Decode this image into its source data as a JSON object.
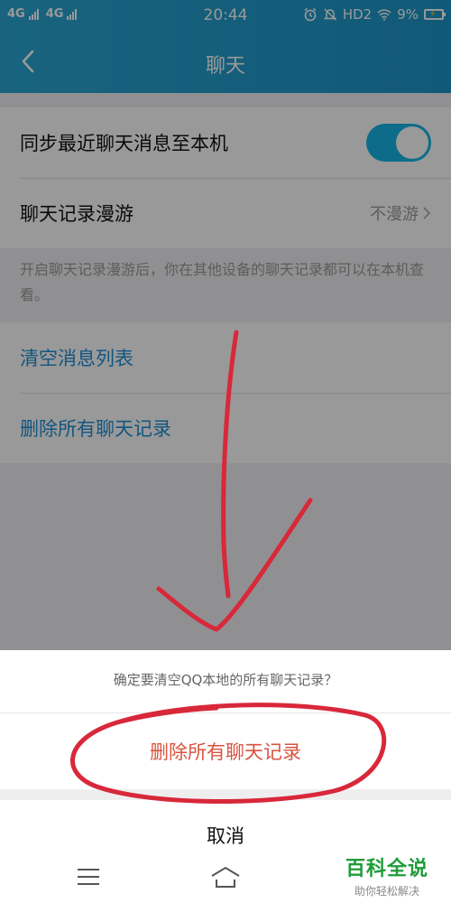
{
  "status_bar": {
    "network1": "4G",
    "network2": "4G",
    "time": "20:44",
    "hd": "HD2",
    "battery": "9%"
  },
  "header": {
    "title": "聊天"
  },
  "settings": {
    "sync_label": "同步最近聊天消息至本机",
    "sync_enabled": true,
    "roaming_label": "聊天记录漫游",
    "roaming_value": "不漫游",
    "roaming_desc": "开启聊天记录漫游后，你在其他设备的聊天记录都可以在本机查看。",
    "clear_list_label": "清空消息列表",
    "delete_all_label": "删除所有聊天记录"
  },
  "action_sheet": {
    "message": "确定要清空QQ本地的所有聊天记录？",
    "danger_label": "删除所有聊天记录",
    "cancel_label": "取消"
  },
  "watermark": {
    "title": "百科全说",
    "subtitle": "助你轻松解决"
  },
  "colors": {
    "header": "#1c95c8",
    "toggle_on": "#16b4e6",
    "link": "#1f8fd6",
    "danger": "#d9533f",
    "annotation": "#d8283a"
  },
  "icons": {
    "back": "chevron-left-icon",
    "chevron": "chevron-right-icon",
    "menu": "menu-icon",
    "home": "home-icon"
  }
}
